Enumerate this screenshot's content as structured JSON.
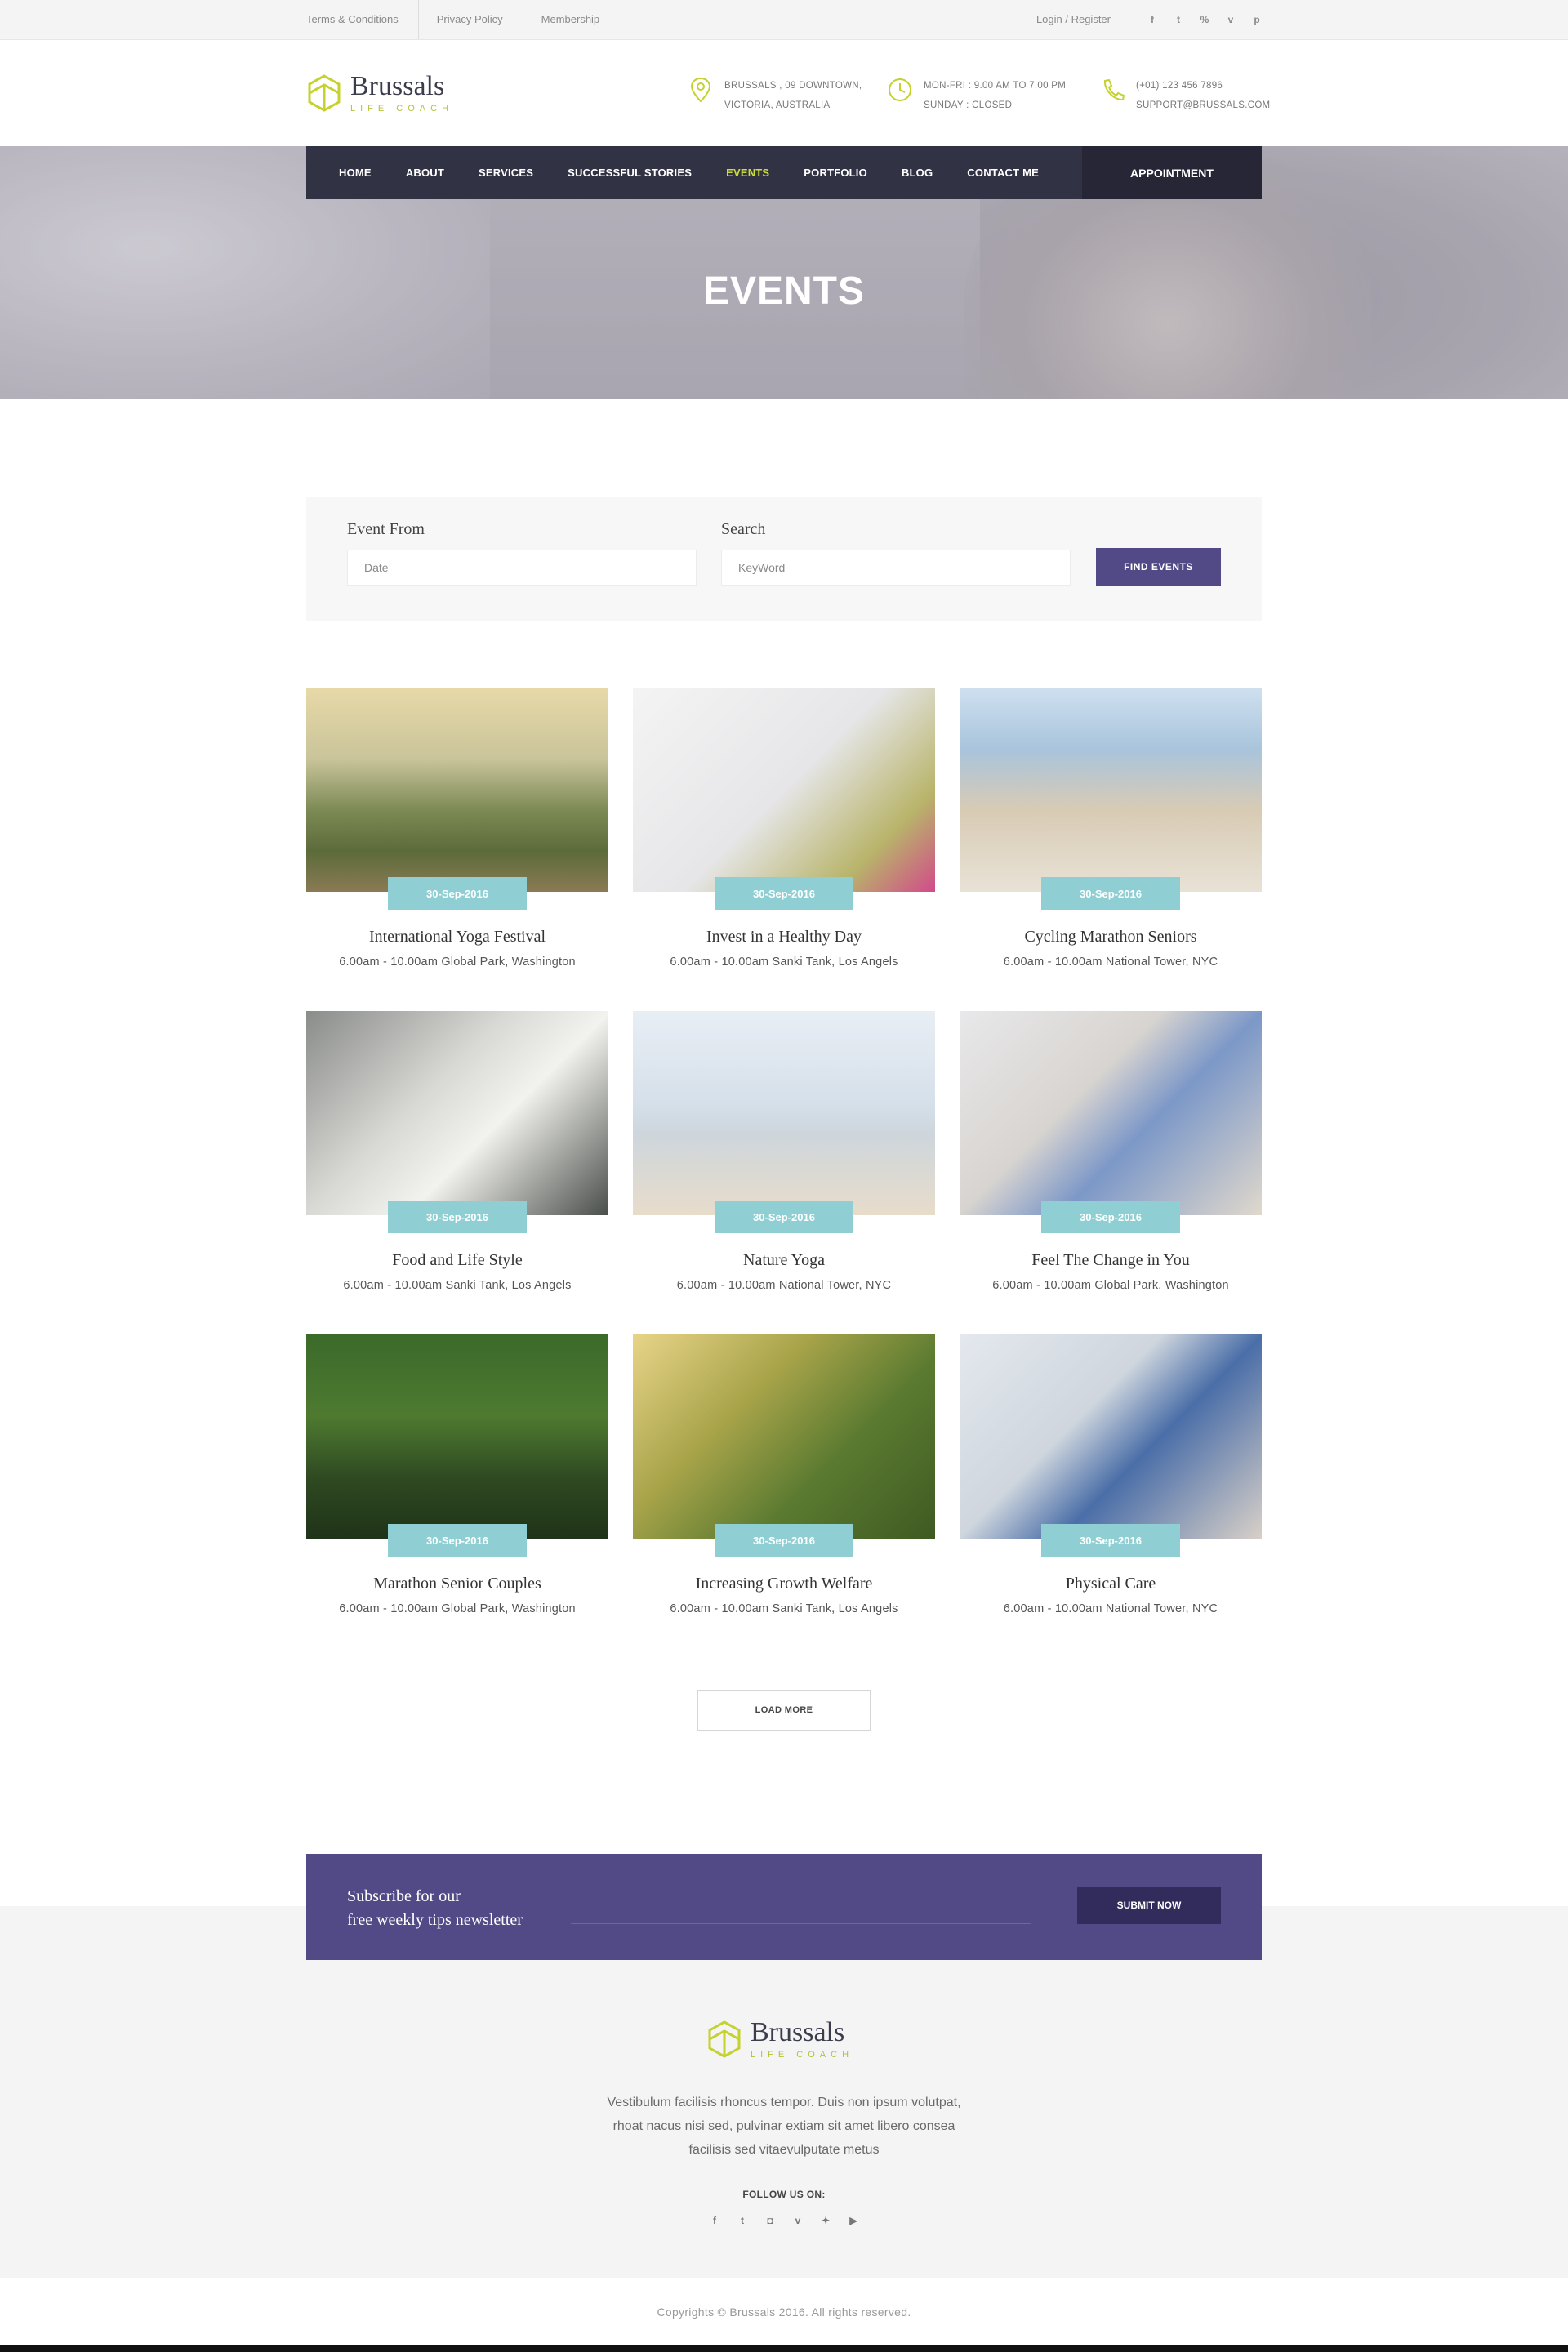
{
  "topbar": {
    "links": [
      "Terms & Conditions",
      "Privacy Policy",
      "Membership"
    ],
    "login": "Login / Register",
    "social_icons": [
      {
        "name": "facebook-icon",
        "glyph": "f"
      },
      {
        "name": "twitter-icon",
        "glyph": "t"
      },
      {
        "name": "link-icon",
        "glyph": "%"
      },
      {
        "name": "vimeo-icon",
        "glyph": "v"
      },
      {
        "name": "pinterest-icon",
        "glyph": "p"
      }
    ]
  },
  "header": {
    "logo_name": "Brussals",
    "logo_sub": "LIFE COACH",
    "address": [
      "BRUSSALS , 09 DOWNTOWN,",
      "VICTORIA, AUSTRALIA"
    ],
    "hours": [
      "MON-FRI : 9.00 AM TO 7.00 PM",
      "SUNDAY : CLOSED"
    ],
    "contact": [
      "(+01) 123 456 7896",
      "SUPPORT@BRUSSALS.COM"
    ]
  },
  "nav": {
    "items": [
      "HOME",
      "ABOUT",
      "SERVICES",
      "SUCCESSFUL STORIES",
      "EVENTS",
      "PORTFOLIO",
      "BLOG",
      "CONTACT ME"
    ],
    "active": "EVENTS",
    "appointment": "APPOINTMENT"
  },
  "hero": {
    "title": "EVENTS"
  },
  "search": {
    "from_label": "Event From",
    "from_placeholder": "Date",
    "search_label": "Search",
    "search_placeholder": "KeyWord",
    "button": "FIND EVENTS"
  },
  "events": [
    {
      "title": "International Yoga Festival",
      "date": "30-Sep-2016",
      "meta": "6.00am - 10.00am Global Park, Washington",
      "image": "yoga-lake"
    },
    {
      "title": "Invest in a Healthy Day",
      "date": "30-Sep-2016",
      "meta": "6.00am - 10.00am Sanki Tank, Los Angels",
      "image": "playroom"
    },
    {
      "title": "Cycling Marathon Seniors",
      "date": "30-Sep-2016",
      "meta": "6.00am - 10.00am National Tower, NYC",
      "image": "seniors-beach"
    },
    {
      "title": "Food and Life Style",
      "date": "30-Sep-2016",
      "meta": "6.00am - 10.00am Sanki Tank, Los Angels",
      "image": "family-kitchen"
    },
    {
      "title": "Nature Yoga",
      "date": "30-Sep-2016",
      "meta": "6.00am - 10.00am National Tower, NYC",
      "image": "beach-yoga"
    },
    {
      "title": "Feel The Change in You",
      "date": "30-Sep-2016",
      "meta": "6.00am - 10.00am Global Park, Washington",
      "image": "counseling"
    },
    {
      "title": "Marathon Senior Couples",
      "date": "30-Sep-2016",
      "meta": "6.00am - 10.00am Global Park, Washington",
      "image": "boat-river"
    },
    {
      "title": "Increasing Growth Welfare",
      "date": "30-Sep-2016",
      "meta": "6.00am - 10.00am Sanki Tank, Los Angels",
      "image": "family-park"
    },
    {
      "title": "Physical Care",
      "date": "30-Sep-2016",
      "meta": "6.00am - 10.00am National Tower, NYC",
      "image": "therapy"
    }
  ],
  "load_more": "LOAD MORE",
  "newsletter": {
    "line1": "Subscribe for our",
    "line2": "free weekly tips newsletter",
    "button": "SUBMIT NOW"
  },
  "footer": {
    "logo_name": "Brussals",
    "logo_sub": "LIFE COACH",
    "desc_lines": [
      "Vestibulum facilisis rhoncus tempor. Duis non ipsum volutpat,",
      "rhoat nacus nisi sed, pulvinar extiam sit amet libero consea",
      "facilisis sed vitaevulputate metus"
    ],
    "follow": "FOLLOW US ON:",
    "icons": [
      {
        "name": "facebook-icon",
        "glyph": "f"
      },
      {
        "name": "twitter-icon",
        "glyph": "t"
      },
      {
        "name": "instagram-icon",
        "glyph": "◘"
      },
      {
        "name": "vine-icon",
        "glyph": "v"
      },
      {
        "name": "dropbox-icon",
        "glyph": "✦"
      },
      {
        "name": "youtube-icon",
        "glyph": "▶"
      }
    ],
    "copyright": "Copyrights © Brussals 2016. All rights reserved."
  },
  "colors": {
    "accent_purple": "#524a86",
    "accent_teal": "#8fcfd3",
    "accent_lime": "#cddc39",
    "nav_dark": "#323245"
  }
}
